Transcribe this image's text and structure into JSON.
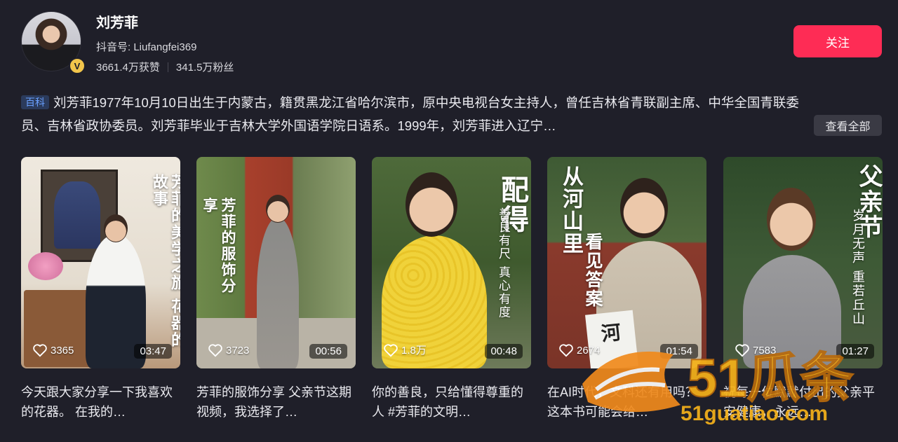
{
  "profile": {
    "name": "刘芳菲",
    "douyin_id": "抖音号: Liufangfei369",
    "likes": "3661.4万获赞",
    "fans": "341.5万粉丝",
    "verified_badge": "V",
    "follow_label": "关注"
  },
  "bio": {
    "tag": "百科",
    "text": "刘芳菲1977年10月10日出生于内蒙古，籍贯黑龙江省哈尔滨市，原中央电视台女主持人，曾任吉林省青联副主席、中华全国青联委员、吉林省政协委员。刘芳菲毕业于吉林大学外国语学院日语系。1999年，刘芳菲进入辽宁…",
    "more_label": "查看全部"
  },
  "videos": [
    {
      "overlay": "芳菲的美学之旅 花器的故事",
      "likes": "3365",
      "duration": "03:47",
      "desc": "今天跟大家分享一下我喜欢的花器。 在我的…"
    },
    {
      "overlay": "芳菲的服饰分享",
      "likes": "3723",
      "duration": "00:56",
      "desc": "芳菲的服饰分享 父亲节这期视频，我选择了…"
    },
    {
      "overlay_big": "配得",
      "overlay_small": "善良有尺 真心有度",
      "likes": "1.8万",
      "duration": "00:48",
      "desc": "你的善良，只给懂得尊重的人 #芳菲的文明…"
    },
    {
      "overlay_big": "从河山里",
      "overlay_small": "看见答案",
      "board": "河",
      "likes": "2674",
      "duration": "01:54",
      "desc": "在AI时代，文科还有用吗？这本书可能会给…"
    },
    {
      "overlay_big": "父亲节",
      "overlay_small": "岁月无声 重若丘山",
      "likes": "7583",
      "duration": "01:27",
      "desc": "祝每一位默默付出的父亲平安健康，永远…"
    }
  ],
  "watermark": {
    "brand": "51瓜条",
    "url": "51guatiao.com"
  },
  "colors": {
    "background": "#1f1f29",
    "accent": "#fe2c55",
    "tag_bg": "#2b3b5c",
    "tag_text": "#6aa0ff"
  }
}
